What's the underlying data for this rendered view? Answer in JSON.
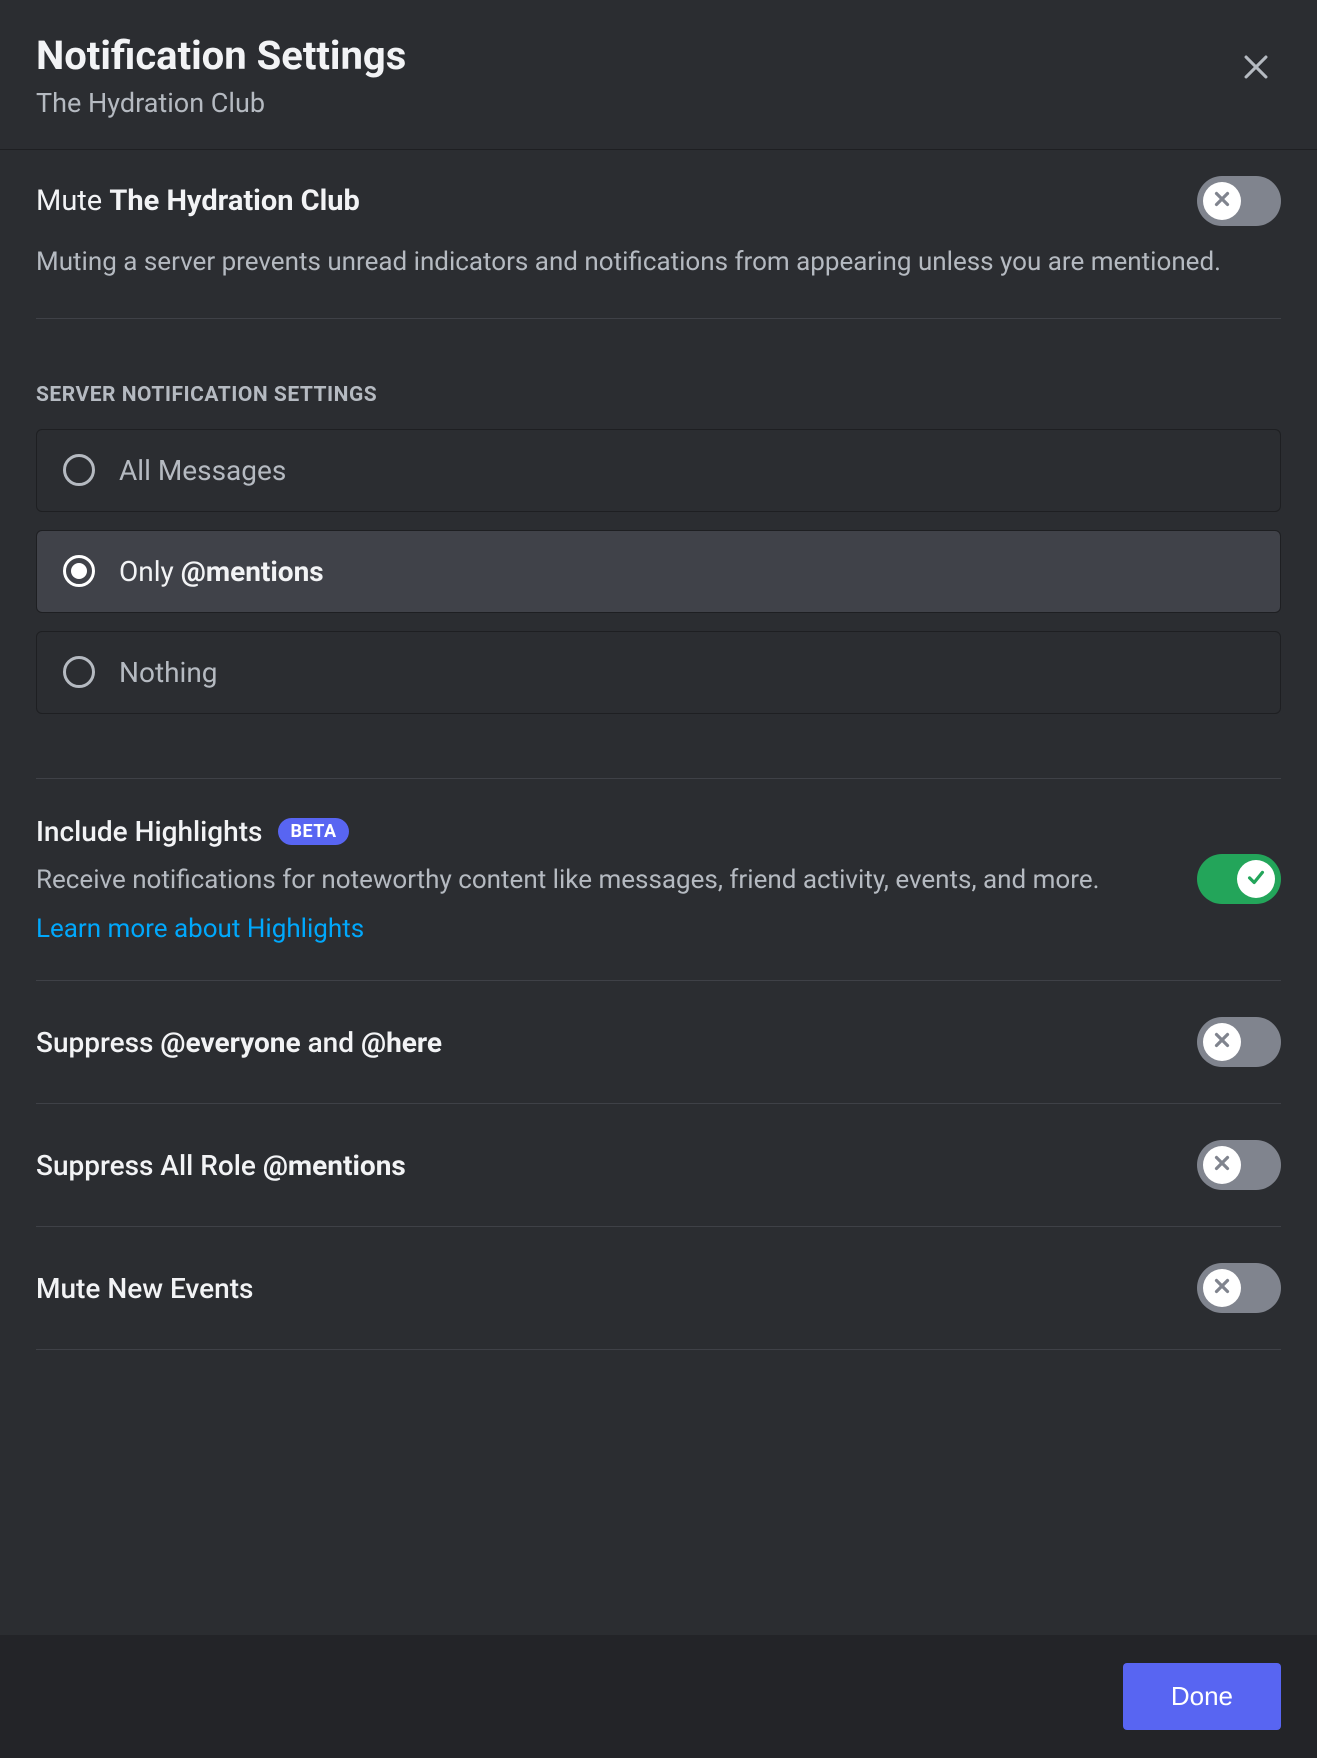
{
  "header": {
    "title": "Notification Settings",
    "subtitle": "The Hydration Club"
  },
  "mute": {
    "label_prefix": "Mute ",
    "label_bold": "The Hydration Club",
    "description": "Muting a server prevents unread indicators and notifications from appearing unless you are mentioned.",
    "enabled": false
  },
  "notification_settings": {
    "heading": "SERVER NOTIFICATION SETTINGS",
    "options": [
      {
        "label_plain": "All Messages",
        "label_bold": "",
        "selected": false
      },
      {
        "label_plain": "Only ",
        "label_bold": "@mentions",
        "selected": true
      },
      {
        "label_plain": "Nothing",
        "label_bold": "",
        "selected": false
      }
    ]
  },
  "highlights": {
    "title": "Include Highlights",
    "badge": "BETA",
    "description": "Receive notifications for noteworthy content like messages, friend activity, events, and more.",
    "link_text": "Learn more about Highlights",
    "enabled": true
  },
  "suppress_everyone": {
    "title_pre": "Suppress ",
    "title_b1": "@everyone",
    "title_mid": " and ",
    "title_b2": "@here",
    "enabled": false
  },
  "suppress_roles": {
    "title_pre": "Suppress All Role ",
    "title_bold": "@mentions",
    "enabled": false
  },
  "mute_events": {
    "title": "Mute New Events",
    "enabled": false
  },
  "footer": {
    "done": "Done"
  }
}
